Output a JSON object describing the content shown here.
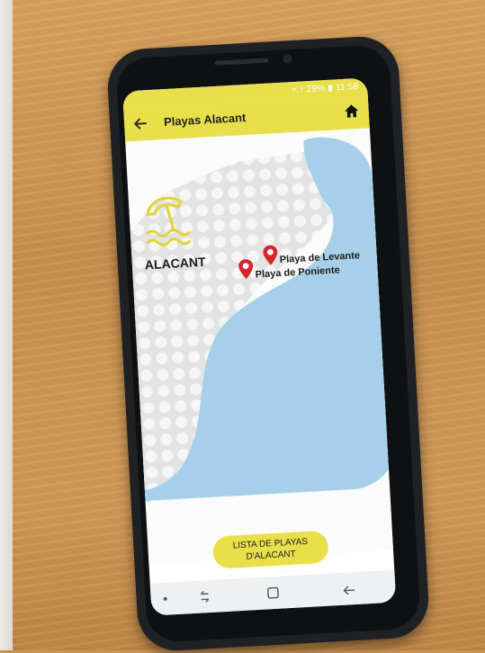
{
  "status_bar": {
    "text": "≈.↑ 29% ▮ 11:58"
  },
  "app_bar": {
    "title": "Playas Alacant",
    "back_icon": "back-arrow-icon",
    "home_icon": "home-icon"
  },
  "map": {
    "city_label": "ALACANT",
    "markers": [
      {
        "label": "Playa de Levante"
      },
      {
        "label": "Playa de Poniente"
      }
    ],
    "colors": {
      "sea": "#a6d0e9",
      "land_dots": "#dddddd",
      "marker": "#d7262b",
      "logo": "#e3d33a"
    }
  },
  "list_button": {
    "label_line1": "LISTA DE PLAYAS",
    "label_line2": "D'ALACANT"
  },
  "nav_bar": {
    "icons": [
      "recent-apps-icon",
      "home-square-icon",
      "back-nav-icon"
    ]
  },
  "colors": {
    "accent": "#e8df4b"
  }
}
